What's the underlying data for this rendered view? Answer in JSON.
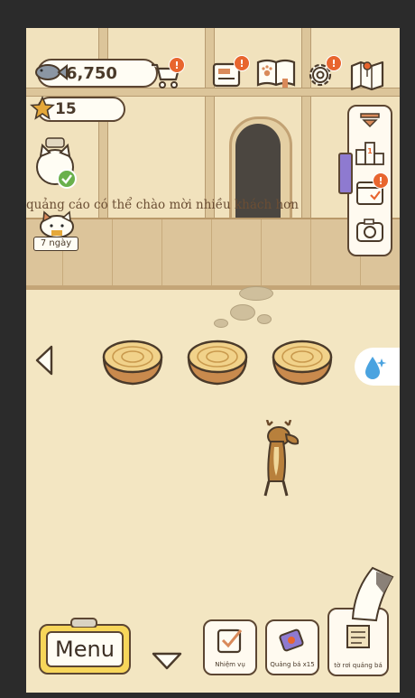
{
  "hud": {
    "fish_count": "6,750",
    "star_count": "15"
  },
  "marquee": {
    "text": "quảng cáo có thể chào mời nhiều khách hơn"
  },
  "visitor": {
    "days_label": "7 ngày"
  },
  "menu": {
    "label": "Menu"
  },
  "bottom_bar": {
    "quest_label": "Nhiệm vụ",
    "ad_label": "Quảng bá x15",
    "flyer_label": "tờ rơi quảng bá"
  },
  "badges": {
    "shop": "!",
    "notice": "!",
    "catbook": "!",
    "settings": "!",
    "calendar": "!"
  },
  "colors": {
    "outline": "#5c4632",
    "badge": "#e8652e",
    "menu_yellow": "#f7d65a",
    "wood": "#dcc49a"
  }
}
